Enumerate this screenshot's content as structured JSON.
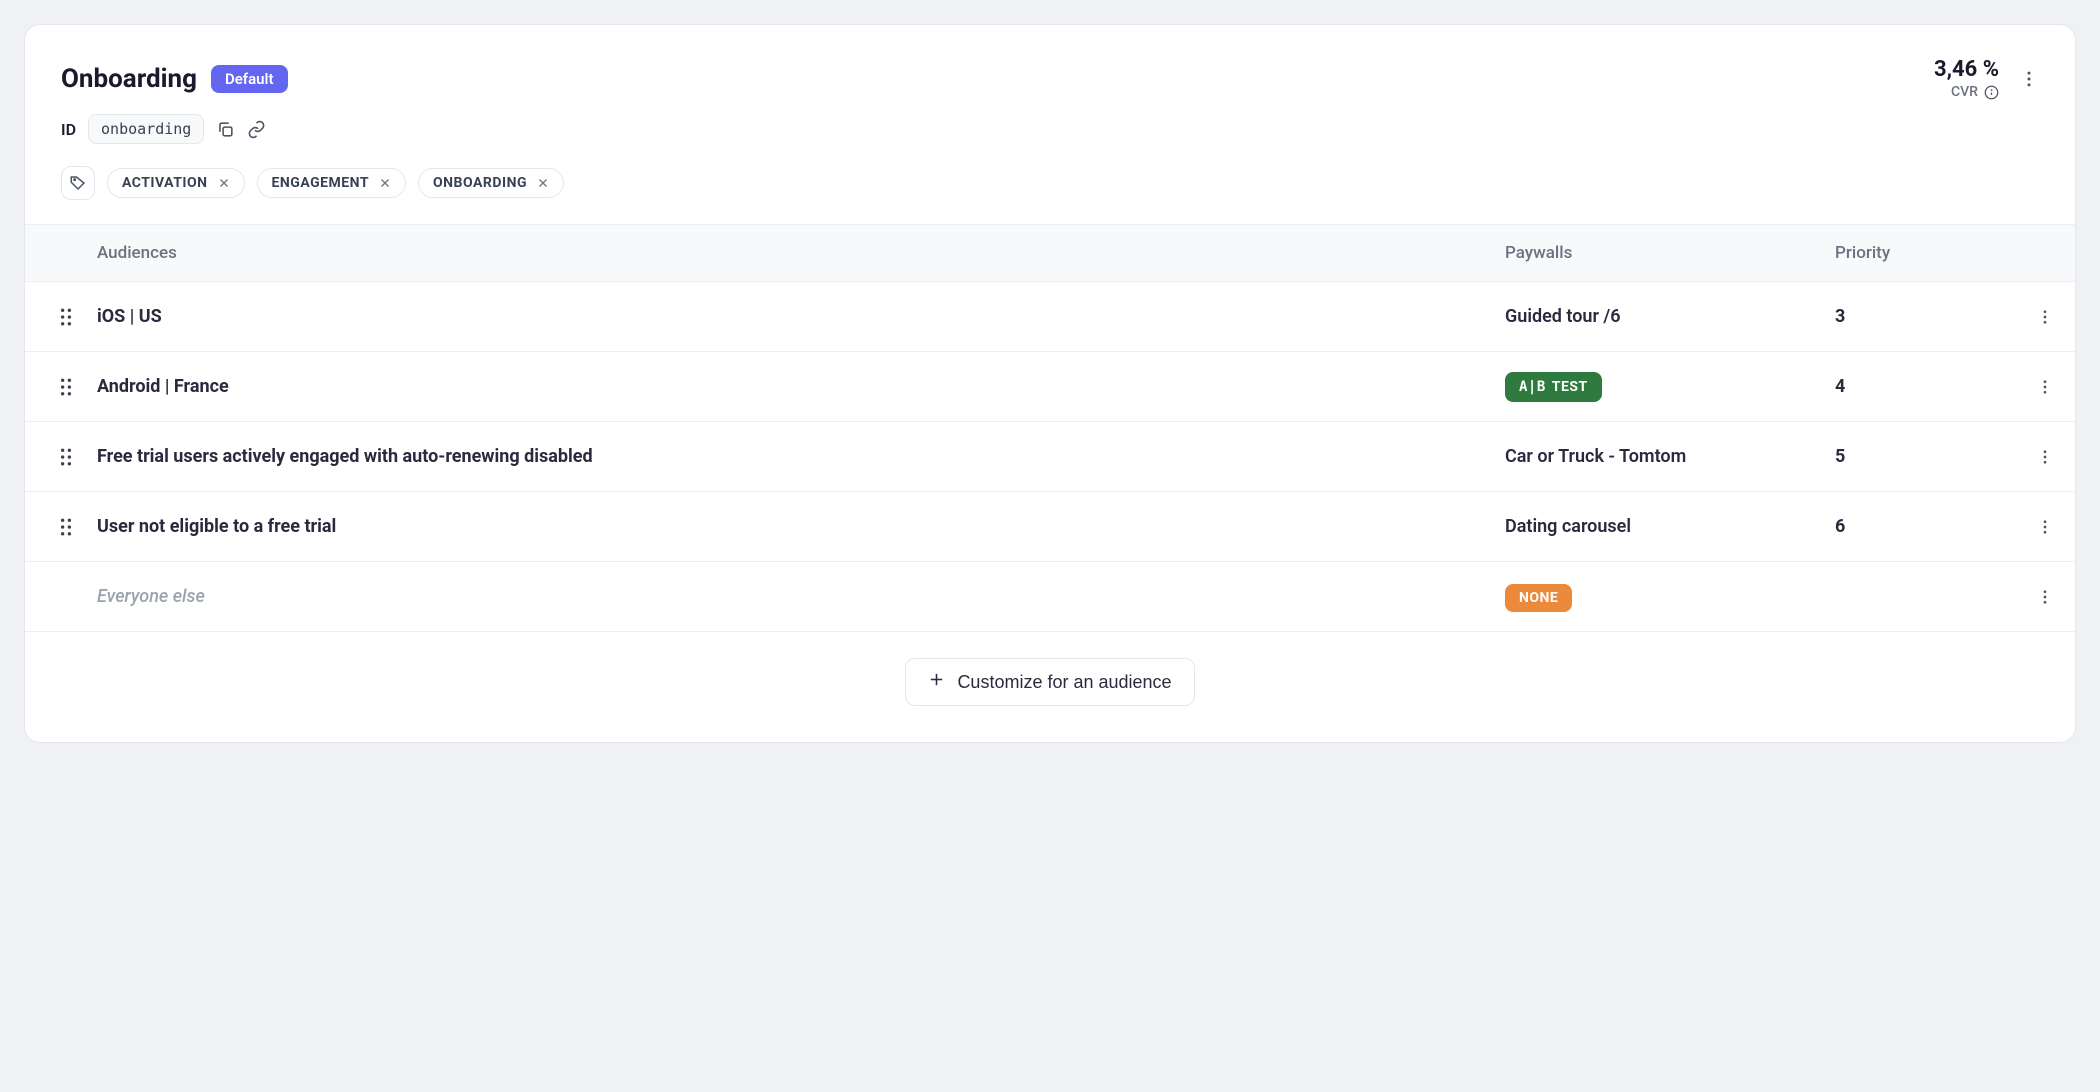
{
  "header": {
    "title": "Onboarding",
    "default_badge": "Default",
    "id_label": "ID",
    "id_value": "onboarding",
    "cvr_value": "3,46 %",
    "cvr_label": "CVR"
  },
  "tags": [
    "ACTIVATION",
    "ENGAGEMENT",
    "ONBOARDING"
  ],
  "columns": {
    "audiences": "Audiences",
    "paywalls": "Paywalls",
    "priority": "Priority"
  },
  "rows": [
    {
      "audience": "iOS | US",
      "paywall_text": "Guided tour /6",
      "paywall_type": "text",
      "priority": "3",
      "draggable": true
    },
    {
      "audience": "Android | France",
      "paywall_text": "TEST",
      "paywall_type": "ab",
      "priority": "4",
      "draggable": true
    },
    {
      "audience": "Free trial users actively engaged with auto-renewing disabled",
      "paywall_text": "Car or Truck - Tomtom",
      "paywall_type": "text",
      "priority": "5",
      "draggable": true
    },
    {
      "audience": "User not eligible to a free trial",
      "paywall_text": "Dating carousel",
      "paywall_type": "text",
      "priority": "6",
      "draggable": true
    },
    {
      "audience": "Everyone else",
      "paywall_text": "NONE",
      "paywall_type": "none",
      "priority": "",
      "draggable": false,
      "italic": true
    }
  ],
  "customize_button": "Customize for an audience",
  "ab_prefix": "A|B"
}
